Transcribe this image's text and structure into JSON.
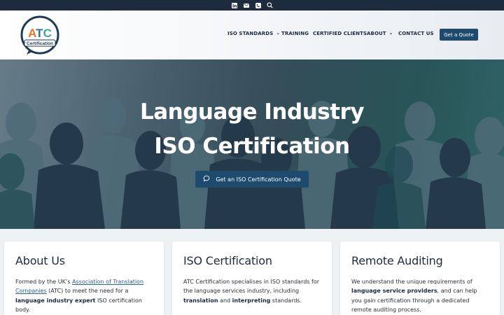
{
  "topbar": {
    "icons": [
      "linkedin-icon",
      "mail-icon",
      "phone-icon",
      "search-icon"
    ]
  },
  "header": {
    "logo_text_main": "ATC",
    "logo_text_sub": "Certification",
    "nav": [
      {
        "label": "ISO STANDARDS",
        "has_dropdown": true
      },
      {
        "label": "TRAINING",
        "has_dropdown": false
      },
      {
        "label": "CERTIFIED CLIENTS",
        "has_dropdown": false
      },
      {
        "label": "ABOUT",
        "has_dropdown": true
      },
      {
        "label": "CONTACT US",
        "has_dropdown": false
      }
    ],
    "cta_label": "Get a Quote"
  },
  "hero": {
    "title_line1": "Language Industry",
    "title_line2": "ISO Certification",
    "button_label": "Get an ISO Certification Quote",
    "button_icon": "chat-bubble-icon"
  },
  "cards": [
    {
      "title": "About Us",
      "p1": "Formed by the UK’s ",
      "link": "Association of Translation Companies",
      "p2": " (ATC) to meet the need for a ",
      "bold1": "language industry expert",
      "p3": " ISO certification body."
    },
    {
      "title": "ISO Certification",
      "p1": "ATC Certification specialises in ISO standards for the language services industry, including ",
      "bold1": "translation",
      "p2": " and ",
      "bold2": "interpreting",
      "p3": " standards."
    },
    {
      "title": "Remote Auditing",
      "p1": "We understand the unique requirements of ",
      "bold1": "language service providers",
      "p2": ", and can help you gain certification through a dedicated remote auditing process."
    }
  ],
  "colors": {
    "navy": "#1d2b3e",
    "button_blue": "#1e4a6d",
    "logo_orange": "#e8732a",
    "logo_blue": "#2b6fa8",
    "logo_teal": "#3aa6a0"
  }
}
